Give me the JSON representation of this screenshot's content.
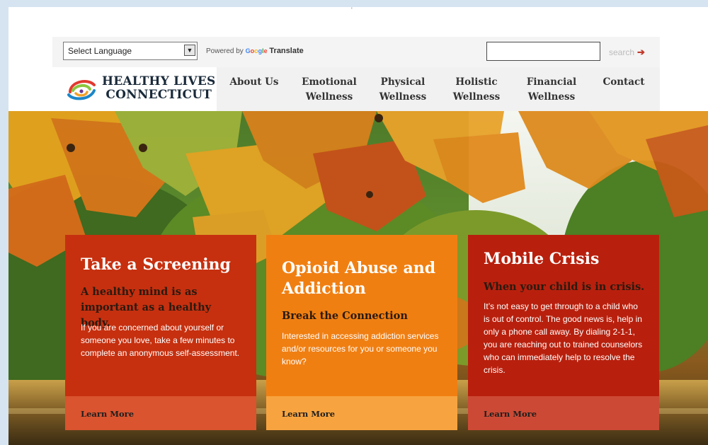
{
  "header": {
    "language_select": "Select Language",
    "powered_by": "Powered by",
    "google": "Google",
    "translate": "Translate",
    "search_label": "search"
  },
  "logo": {
    "line1": "HEALTHY LIVES",
    "line2": "CONNECTICUT"
  },
  "nav": {
    "items": [
      {
        "label": "About Us"
      },
      {
        "label": "Emotional\nWellness"
      },
      {
        "label": "Physical\nWellness"
      },
      {
        "label": "Holistic\nWellness"
      },
      {
        "label": "Financial\nWellness"
      },
      {
        "label": "Contact"
      }
    ]
  },
  "cards": [
    {
      "title": "Take a Screening",
      "subtitle": "A healthy mind is as important as a healthy body.",
      "body": "If you are concerned about yourself or someone you love, take a few minutes to complete an anonymous self-assessment.",
      "link": "Learn More",
      "color": "#c6300f"
    },
    {
      "title": "Opioid Abuse and Addiction",
      "subtitle": "Break the Connection",
      "body": "Interested in accessing addiction services and/or resources for you or someone you know?",
      "link": "Learn More",
      "color": "#f07f12"
    },
    {
      "title": "Mobile Crisis",
      "subtitle": "When your child is in crisis.",
      "body": "It’s not easy to get through to a child who is out of control. The good news is, help in only a phone call away. By dialing 2-1-1, you are reaching out to trained counselors who can immediately help to resolve the crisis.",
      "link": "Learn More",
      "color": "#b8200d"
    }
  ]
}
